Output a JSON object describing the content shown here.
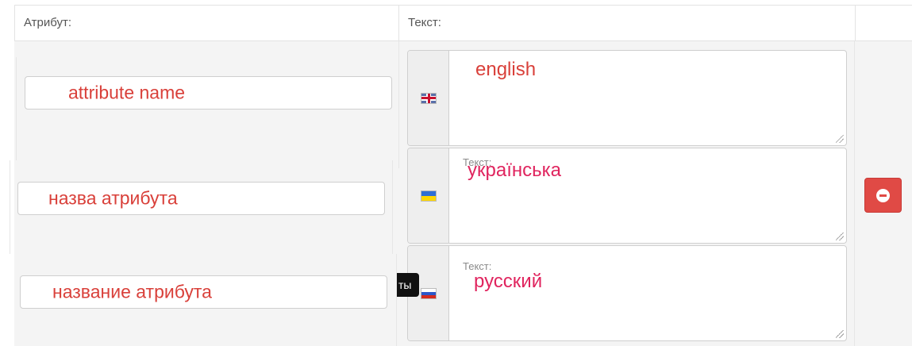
{
  "table": {
    "headers": {
      "attribute": "Атрибут:",
      "text": "Текст:"
    }
  },
  "rows": {
    "en": {
      "attribute_value": "attribute name",
      "text_placeholder": "",
      "text_value": "english",
      "flag": "uk-flag-icon"
    },
    "uk": {
      "attribute_value": "назва атрибута",
      "text_placeholder": "Текст:",
      "text_value": "українська",
      "flag": "ua-flag-icon"
    },
    "ru": {
      "attribute_value": "название атрибута",
      "text_placeholder": "Текст:",
      "text_value": "русский",
      "flag": "ru-flag-icon"
    }
  },
  "tooltip": {
    "text": "ты"
  },
  "remove_button": {
    "icon": "minus-circle-icon",
    "color": "#e04a45"
  },
  "colors": {
    "annotation_red": "#d9403a",
    "annotation_pink": "#e0245e"
  }
}
